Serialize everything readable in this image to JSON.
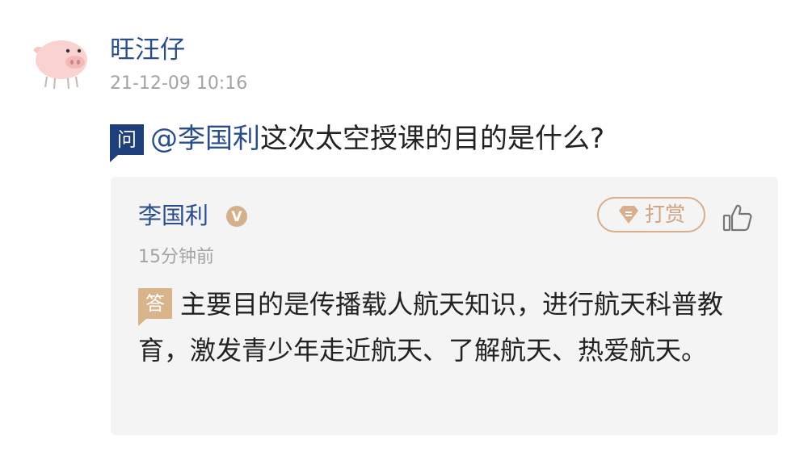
{
  "post": {
    "username": "旺汪仔",
    "timestamp": "21-12-09 10:16"
  },
  "question": {
    "badge": "问",
    "mention": "@李国利",
    "text": "这次太空授课的目的是什么?"
  },
  "answer": {
    "author": "李国利",
    "verified_badge": "V",
    "time": "15分钟前",
    "badge": "答",
    "text": "主要目的是传播载人航天知识，进行航天科普教育，激发青少年走近航天、了解航天、热爱航天。",
    "reward_label": "打赏"
  },
  "colors": {
    "link_blue": "#2a4e8c",
    "question_badge": "#1e3f7a",
    "answer_badge": "#d9b389",
    "reward_accent": "#d0a27f",
    "card_background": "#f4f4f4",
    "meta_gray": "#a3a3a3"
  },
  "icons": {
    "avatar": "pig-avatar",
    "verified": "verified-v-icon",
    "reward": "diamond-gift-icon",
    "like": "thumbs-up-icon"
  }
}
